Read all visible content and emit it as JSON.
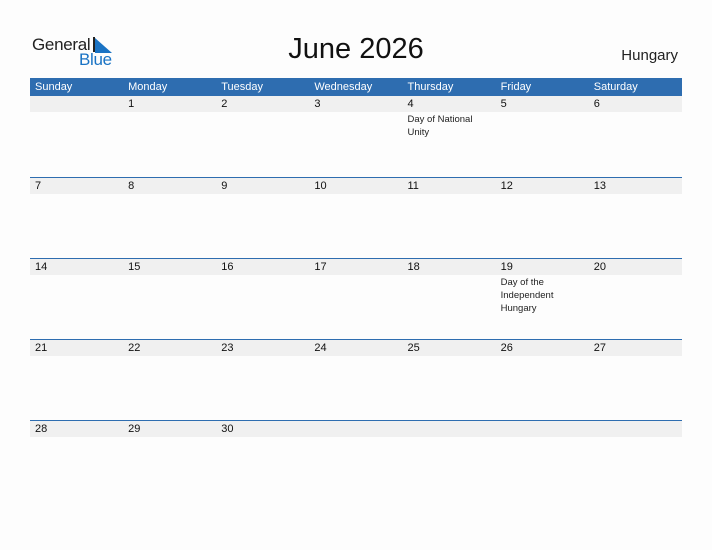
{
  "logo": {
    "word1": "General",
    "word2": "Blue"
  },
  "title": "June 2026",
  "country": "Hungary",
  "colors": {
    "header_bg": "#2e6db0",
    "band_bg": "#f0f0f0",
    "logo_blue": "#1a73c4"
  },
  "weekdays": [
    "Sunday",
    "Monday",
    "Tuesday",
    "Wednesday",
    "Thursday",
    "Friday",
    "Saturday"
  ],
  "weeks": [
    [
      {
        "day": ""
      },
      {
        "day": "1"
      },
      {
        "day": "2"
      },
      {
        "day": "3"
      },
      {
        "day": "4",
        "event": "Day of National Unity"
      },
      {
        "day": "5"
      },
      {
        "day": "6"
      }
    ],
    [
      {
        "day": "7"
      },
      {
        "day": "8"
      },
      {
        "day": "9"
      },
      {
        "day": "10"
      },
      {
        "day": "11"
      },
      {
        "day": "12"
      },
      {
        "day": "13"
      }
    ],
    [
      {
        "day": "14"
      },
      {
        "day": "15"
      },
      {
        "day": "16"
      },
      {
        "day": "17"
      },
      {
        "day": "18"
      },
      {
        "day": "19",
        "event": "Day of the Independent Hungary"
      },
      {
        "day": "20"
      }
    ],
    [
      {
        "day": "21"
      },
      {
        "day": "22"
      },
      {
        "day": "23"
      },
      {
        "day": "24"
      },
      {
        "day": "25"
      },
      {
        "day": "26"
      },
      {
        "day": "27"
      }
    ],
    [
      {
        "day": "28"
      },
      {
        "day": "29"
      },
      {
        "day": "30"
      },
      {
        "day": ""
      },
      {
        "day": ""
      },
      {
        "day": ""
      },
      {
        "day": ""
      }
    ]
  ]
}
